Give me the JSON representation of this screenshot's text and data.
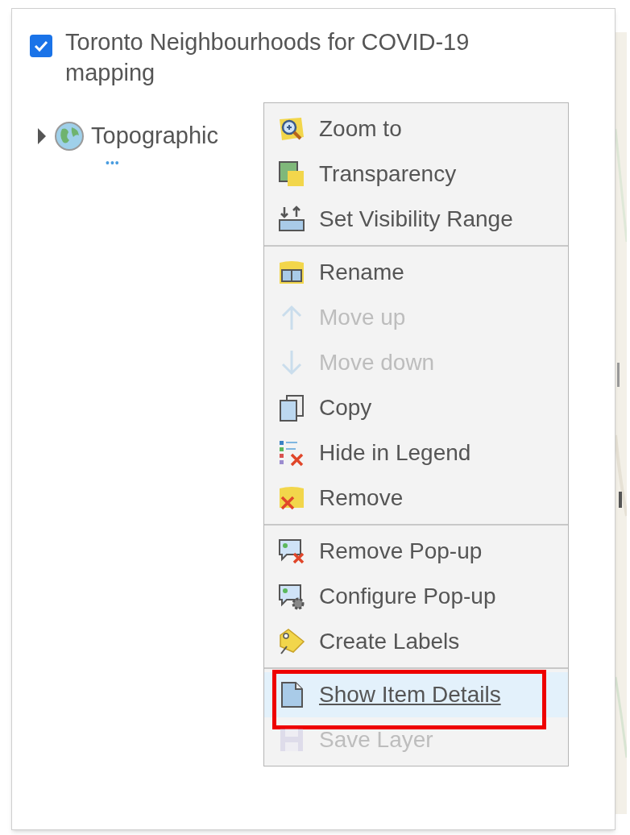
{
  "layer": {
    "title": "Toronto Neighbourhoods for COVID-19 mapping",
    "checked": true
  },
  "basemap": {
    "label": "Topographic",
    "expanded": false,
    "more": "•••"
  },
  "menu": {
    "groups": [
      {
        "items": [
          {
            "kind": "zoom",
            "label": "Zoom to",
            "disabled": false,
            "selected": false,
            "annotated": false
          },
          {
            "kind": "transparency",
            "label": "Transparency",
            "disabled": false,
            "selected": false,
            "annotated": false
          },
          {
            "kind": "visibility",
            "label": "Set Visibility Range",
            "disabled": false,
            "selected": false,
            "annotated": false
          }
        ]
      },
      {
        "items": [
          {
            "kind": "rename",
            "label": "Rename",
            "disabled": false,
            "selected": false,
            "annotated": false
          },
          {
            "kind": "up",
            "label": "Move up",
            "disabled": true,
            "selected": false,
            "annotated": false
          },
          {
            "kind": "down",
            "label": "Move down",
            "disabled": true,
            "selected": false,
            "annotated": false
          },
          {
            "kind": "copy",
            "label": "Copy",
            "disabled": false,
            "selected": false,
            "annotated": false
          },
          {
            "kind": "legend",
            "label": "Hide in Legend",
            "disabled": false,
            "selected": false,
            "annotated": false
          },
          {
            "kind": "remove",
            "label": "Remove",
            "disabled": false,
            "selected": false,
            "annotated": false
          }
        ]
      },
      {
        "items": [
          {
            "kind": "popup-remove",
            "label": "Remove Pop-up",
            "disabled": false,
            "selected": false,
            "annotated": false
          },
          {
            "kind": "popup-config",
            "label": "Configure Pop-up",
            "disabled": false,
            "selected": false,
            "annotated": false
          },
          {
            "kind": "labels",
            "label": "Create Labels",
            "disabled": false,
            "selected": false,
            "annotated": false
          }
        ]
      },
      {
        "items": [
          {
            "kind": "details",
            "label": "Show Item Details",
            "disabled": false,
            "selected": true,
            "annotated": true
          },
          {
            "kind": "save",
            "label": "Save Layer",
            "disabled": true,
            "selected": false,
            "annotated": false
          }
        ]
      }
    ]
  }
}
